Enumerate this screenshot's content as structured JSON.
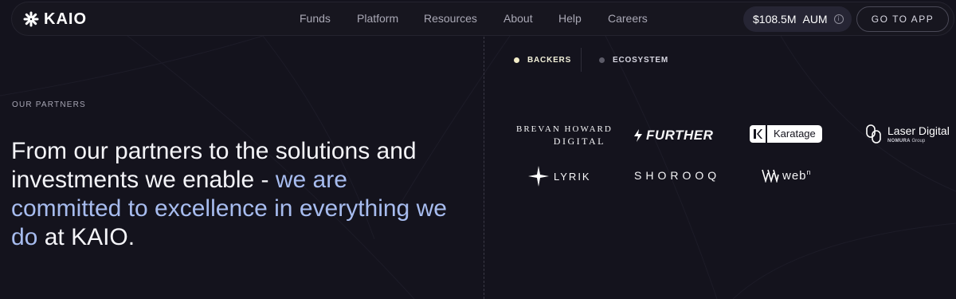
{
  "brand": {
    "name": "KAIO",
    "icon": "kaio-star-icon"
  },
  "nav": {
    "links": [
      "Funds",
      "Platform",
      "Resources",
      "About",
      "Help",
      "Careers"
    ],
    "aum_value": "$108.5M",
    "aum_unit": "AUM",
    "info_icon": "info-icon",
    "cta": "GO TO APP"
  },
  "section": {
    "eyebrow": "OUR PARTNERS",
    "headline_white_1": "From our partners to the solutions and investments we enable -",
    "headline_blue": "we are committed to excellence in everything we do",
    "headline_white_2": " at KAIO."
  },
  "tabs": [
    {
      "label": "BACKERS",
      "active": true
    },
    {
      "label": "ECOSYSTEM",
      "active": false
    }
  ],
  "partners": {
    "brevan_top": "BREVAN HOWARD",
    "brevan_bottom": "DIGITAL",
    "further": "FURTHER",
    "karatage": "Karatage",
    "laser_main": "Laser Digital",
    "laser_sub_bold": "NOMURA",
    "laser_sub": "Group",
    "lyrik": "LYRIK",
    "shorooq": "SHOROOQ",
    "webn": "web",
    "webn_sup": "n"
  },
  "colors": {
    "background": "#14131d",
    "accent_blue": "#a7bcef",
    "active_dot": "#f3edc9"
  }
}
